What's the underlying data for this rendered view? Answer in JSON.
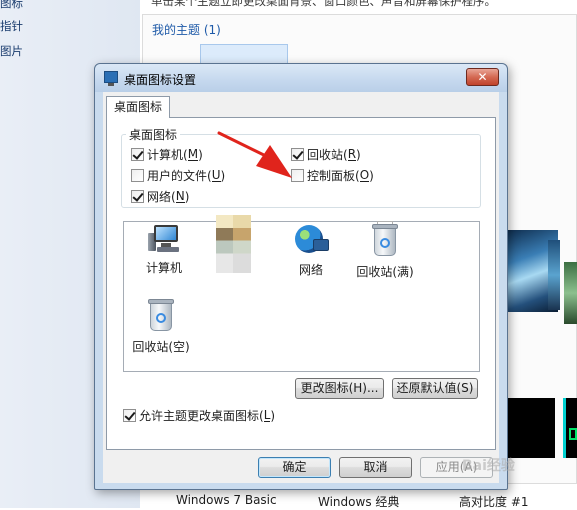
{
  "background": {
    "nav_items": [
      "图标",
      "指针",
      "图片"
    ],
    "description": "单击某个主题立即更改桌面背景、窗口颜色、声音和屏幕保护程序。",
    "my_themes_label": "我的主题 (1)",
    "theme_names": [
      "Windows 7 Basic",
      "Windows 经典",
      "高对比度 #1"
    ]
  },
  "dialog": {
    "title": "桌面图标设置",
    "close_glyph": "✕",
    "tab_label": "桌面图标",
    "group_label": "桌面图标",
    "checkboxes": [
      {
        "label": "计算机",
        "mnemonic": "M",
        "checked": true
      },
      {
        "label": "回收站",
        "mnemonic": "R",
        "checked": true
      },
      {
        "label": "用户的文件",
        "mnemonic": "U",
        "checked": false
      },
      {
        "label": "控制面板",
        "mnemonic": "O",
        "checked": false
      },
      {
        "label": "网络",
        "mnemonic": "N",
        "checked": true
      }
    ],
    "icons": [
      {
        "label": "计算机",
        "icon": "computer-icon"
      },
      {
        "label": "",
        "icon": "user-files-icon-blurred"
      },
      {
        "label": "网络",
        "icon": "network-globe-icon"
      },
      {
        "label": "回收站(满)",
        "icon": "recycle-bin-full-icon"
      },
      {
        "label": "回收站(空)",
        "icon": "recycle-bin-empty-icon"
      }
    ],
    "change_icon_button": "更改图标(H)...",
    "restore_default_button": "还原默认值(S)",
    "allow_themes": {
      "label": "允许主题更改桌面图标",
      "mnemonic": "L",
      "checked": true
    },
    "ok_button": "确定",
    "cancel_button": "取消",
    "apply_button": "应用(A)"
  },
  "watermark": "Bai经验",
  "colors": {
    "annotation_arrow": "#e0241c",
    "dialog_frame": "#c9dbee",
    "link_blue": "#1e5aa8"
  }
}
